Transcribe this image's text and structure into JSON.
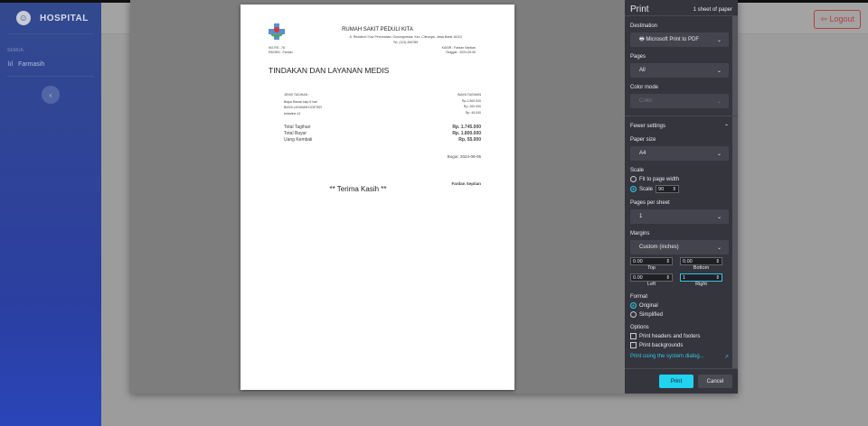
{
  "app": {
    "brand": "HOSPITAL",
    "section": "SEMUA",
    "nav_item": "Farmasih",
    "logout": "Logout"
  },
  "receipt": {
    "hospital": "RUMAH SAKIT PEDULI KITA",
    "address": "Jl. Resident I Kav Perumahan, Gunungmekar, Kec. Cileungsi, Jawa Barat 16113",
    "phone": "Tel. (123) 456789",
    "no_rs": "NO.RS : 78",
    "pasien": "PASIEN : Fardan",
    "kasir": "KASIR : Fardan Septian",
    "tanggal": "Tanggal : 2024-09-05",
    "title": "TINDAKAN DAN LAYANAN MEDIS",
    "col_left": "JENIS TAGIHAN :",
    "col_right": "BIAYA TAGIHAN",
    "items": [
      {
        "name": "Biaya Rawat Inap 5 hari",
        "cost": "Rp.1.500.000"
      },
      {
        "name": "BIAYA LAYANAN DOKTER",
        "cost": "Rp. 200.000"
      },
      {
        "name": "betadine x3",
        "cost": "Rp. 45.000"
      }
    ],
    "totals": [
      {
        "label": "Total Tagihan",
        "value": "Rp. 1.745.000"
      },
      {
        "label": "Total Bayar",
        "value": "Rp. 1.800.000"
      },
      {
        "label": "Uang Kembali",
        "value": "Rp. 55.000"
      }
    ],
    "place_date": "Bogor, 2024-09-05",
    "signer": "Fardan Septian",
    "thanks": "** Terima Kasih **"
  },
  "print": {
    "title": "Print",
    "sheets": "1 sheet of paper",
    "destination_label": "Destination",
    "destination": "Microsoft Print to PDF",
    "pages_label": "Pages",
    "pages": "All",
    "color_label": "Color mode",
    "color": "Color",
    "fewer": "Fewer settings",
    "paper_label": "Paper size",
    "paper": "A4",
    "scale_label": "Scale",
    "fit": "Fit to page width",
    "scale_opt": "Scale",
    "scale_value": "90",
    "pps_label": "Pages per sheet",
    "pps": "1",
    "margins_label": "Margins",
    "margins": "Custom (inches)",
    "top": "0.00",
    "top_label": "Top",
    "bottom": "0.00",
    "bottom_label": "Bottom",
    "left": "0.00",
    "left_label": "Left",
    "right": "1",
    "right_label": "Right",
    "format_label": "Format",
    "original": "Original",
    "simplified": "Simplified",
    "options_label": "Options",
    "headers": "Print headers and footers",
    "backgrounds": "Print backgrounds",
    "system": "Print using the system dialog...",
    "print_btn": "Print",
    "cancel_btn": "Cancel"
  }
}
